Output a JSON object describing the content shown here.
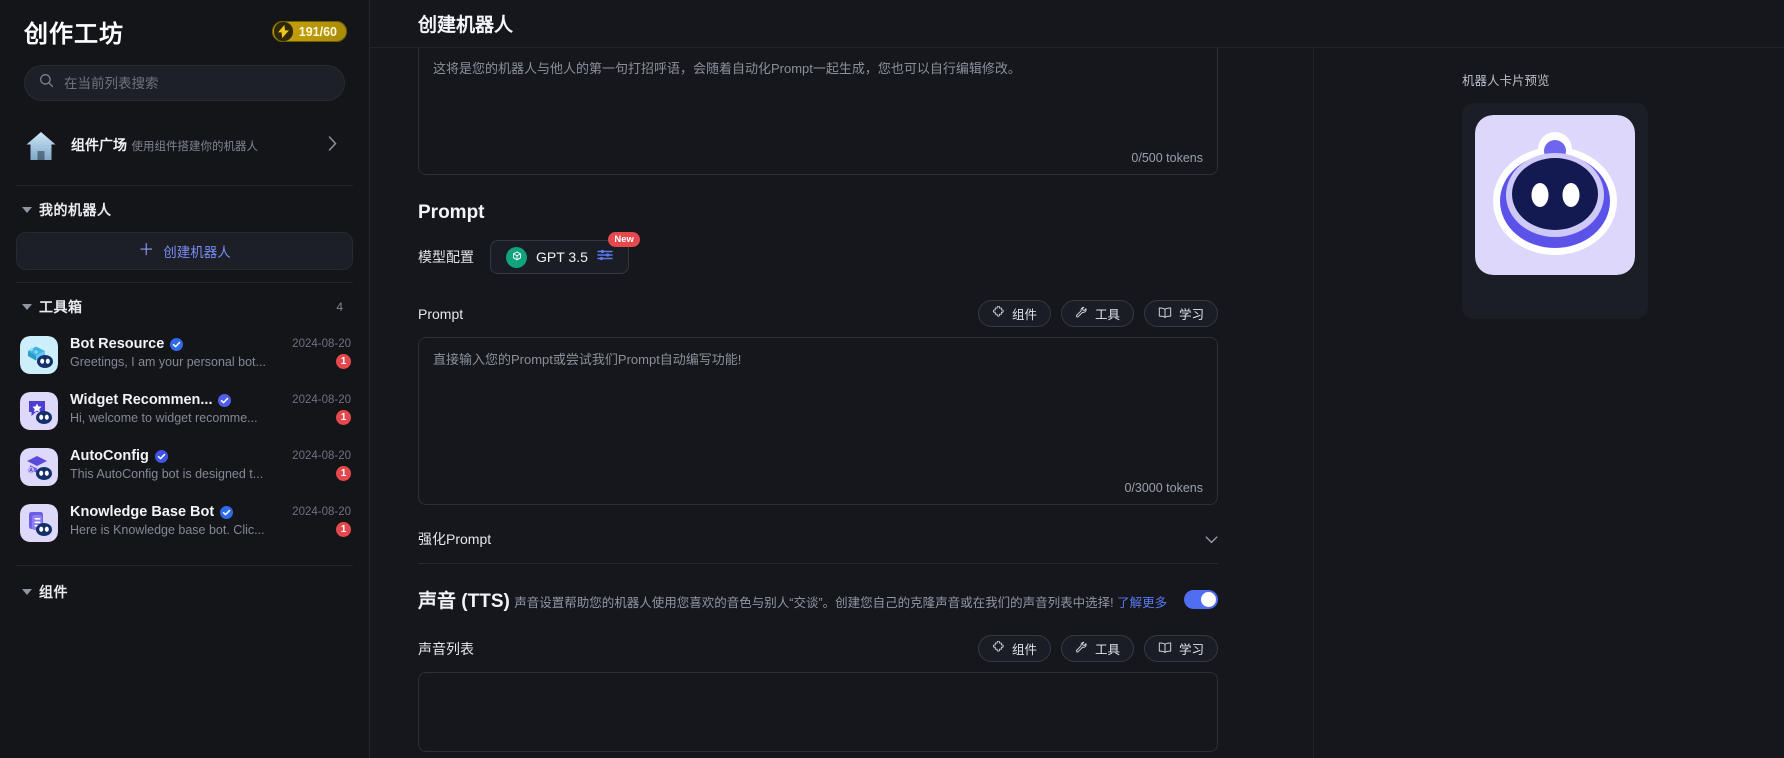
{
  "sidebar": {
    "title": "创作工坊",
    "energy": {
      "icon": "bolt-icon",
      "value": "191/60"
    },
    "search": {
      "placeholder": "在当前列表搜索",
      "icon": "search-icon",
      "value": ""
    },
    "market": {
      "icon": "home-icon",
      "title": "组件广场",
      "subtitle": "使用组件搭建你的机器人",
      "chevron": "chevron-right-icon"
    },
    "groups": [
      {
        "label": "我的机器人",
        "count": ""
      },
      {
        "label": "工具箱",
        "count": "4"
      },
      {
        "label": "组件",
        "count": ""
      }
    ],
    "create_button": {
      "label": "创建机器人",
      "icon": "plus-icon"
    },
    "bots": [
      {
        "name": "Bot Resource",
        "verified": true,
        "date": "2024-08-20",
        "desc": "Greetings, I am your personal bot...",
        "badge": "1",
        "avatar": "bot-resource-avatar"
      },
      {
        "name": "Widget Recommen...",
        "verified": true,
        "date": "2024-08-20",
        "desc": "Hi, welcome to widget recomme...",
        "badge": "1",
        "avatar": "widget-recommend-avatar"
      },
      {
        "name": "AutoConfig",
        "verified": true,
        "date": "2024-08-20",
        "desc": "This AutoConfig bot is designed t...",
        "badge": "1",
        "avatar": "autoconfig-avatar"
      },
      {
        "name": "Knowledge Base Bot",
        "verified": true,
        "date": "2024-08-20",
        "desc": "Here is Knowledge base bot. Clic...",
        "badge": "1",
        "avatar": "knowledge-base-avatar"
      }
    ]
  },
  "main": {
    "title": "创建机器人",
    "greeting": {
      "placeholder": "这将是您的机器人与他人的第一句打招呼语，会随着自动化Prompt一起生成，您也可以自行编辑修改。",
      "tokens": "0/500 tokens"
    },
    "prompt_section": {
      "heading": "Prompt",
      "model_label": "模型配置",
      "model_name": "GPT 3.5",
      "model_icon": "openai-icon",
      "settings_icon": "sliders-icon",
      "new_badge": "New",
      "field_label": "Prompt",
      "placeholder": "直接输入您的Prompt或尝试我们Prompt自动编写功能!",
      "tokens": "0/3000 tokens",
      "actions": [
        {
          "label": "组件",
          "icon": "puzzle-icon"
        },
        {
          "label": "工具",
          "icon": "wrench-icon"
        },
        {
          "label": "学习",
          "icon": "book-icon"
        }
      ]
    },
    "enhance_prompt": {
      "label": "强化Prompt",
      "chevron": "chevron-down-icon"
    },
    "tts": {
      "title": "声音 (TTS)",
      "desc": "声音设置帮助您的机器人使用您喜欢的音色与别人“交谈”。创建您自己的克隆声音或在我们的声音列表中选择!",
      "link": "了解更多",
      "enabled": true,
      "list_label": "声音列表",
      "actions": [
        {
          "label": "组件",
          "icon": "puzzle-icon"
        },
        {
          "label": "工具",
          "icon": "wrench-icon"
        },
        {
          "label": "学习",
          "icon": "book-icon"
        }
      ]
    }
  },
  "preview": {
    "label": "机器人卡片预览",
    "avatar": "robot-head-avatar"
  },
  "colors": {
    "accent": "#4f6ef2",
    "link": "#5b78f0",
    "badge_red": "#e5484d",
    "energy_gold": "#c7a20a",
    "openai_green": "#10a37f",
    "page_bg": "#0d0e13",
    "sidebar_bg": "#131519",
    "main_bg": "#15171d"
  }
}
